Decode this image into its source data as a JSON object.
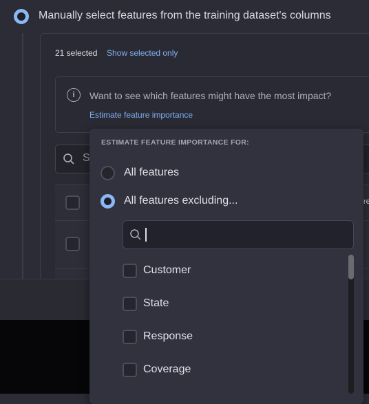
{
  "section": {
    "title": "Manually select features from the training dataset's columns",
    "selected": true
  },
  "panel": {
    "count": "21 selected",
    "show_selected": "Show selected only"
  },
  "info": {
    "text": "Want to see which features might have the most impact?",
    "link": "Estimate feature importance"
  },
  "search": {
    "placeholder_visible": "S"
  },
  "row_edge_text": "re",
  "popup": {
    "header": "ESTIMATE FEATURE IMPORTANCE FOR:",
    "options": [
      {
        "label": "All features",
        "selected": false
      },
      {
        "label": "All features excluding...",
        "selected": true
      }
    ],
    "search_value": "",
    "items": [
      "Customer",
      "State",
      "Response",
      "Coverage"
    ]
  },
  "colors": {
    "accent": "#8ab8f5",
    "link": "#7fb0f0",
    "background": "#2c2c37",
    "popup": "#32323f"
  }
}
